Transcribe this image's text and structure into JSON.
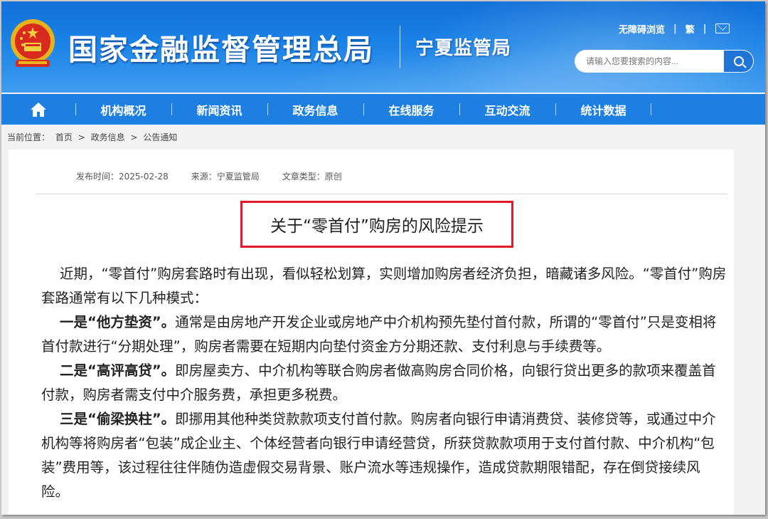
{
  "header": {
    "title": "国家金融监督管理总局",
    "subtitle": "宁夏监管局",
    "links": [
      "无障碍浏览",
      "繁"
    ],
    "icons": {
      "emblem": "national-emblem-icon",
      "mail": "mail-icon",
      "search": "search-icon"
    },
    "search_placeholder": "请输入您要搜索的内容..."
  },
  "nav": {
    "items": [
      "机构概况",
      "新闻资讯",
      "政务信息",
      "在线服务",
      "互动交流",
      "统计数据"
    ],
    "home_icon": "home-icon"
  },
  "breadcrumb": {
    "label": "当前位置：",
    "items": [
      "首页",
      "政务信息",
      "公告通知"
    ],
    "separator": ">"
  },
  "article": {
    "publish_time": "发布时间：2025-02-28",
    "source": "来源：宁夏监管局",
    "type": "文章类型：原创",
    "title": "关于“零首付”购房的风险提示",
    "paragraphs": [
      {
        "lead": "",
        "text": "近期，“零首付”购房套路时有出现，看似轻松划算，实则增加购房者经济负担，暗藏诸多风险。“零首付”购房套路通常有以下几种模式："
      },
      {
        "lead": "一是“他方垫资”。",
        "text": "通常是由房地产开发企业或房地产中介机构预先垫付首付款，所谓的“零首付”只是变相将首付款进行“分期处理”，购房者需要在短期内向垫付资金方分期还款、支付利息与手续费等。"
      },
      {
        "lead": "二是“高评高贷”。",
        "text": "即房屋卖方、中介机构等联合购房者做高购房合同价格，向银行贷出更多的款项来覆盖首付款，购房者需支付中介服务费，承担更多税费。"
      },
      {
        "lead": "三是“偷梁换柱”。",
        "text": "即挪用其他种类贷款款项支付首付款。购房者向银行申请消费贷、装修贷等，或通过中介机构等将购房者“包装”成企业主、个体经营者向银行申请经营贷，所获贷款款项用于支付首付款、中介机构“包装”费用等，该过程往往伴随伪造虚假交易背景、账户流水等违规操作，造成贷款期限错配，存在倒贷接续风险。"
      }
    ]
  },
  "colors": {
    "header_blue": "#1a82e6",
    "nav_blue": "#1d7fe2",
    "highlight_red": "#e2182b"
  }
}
